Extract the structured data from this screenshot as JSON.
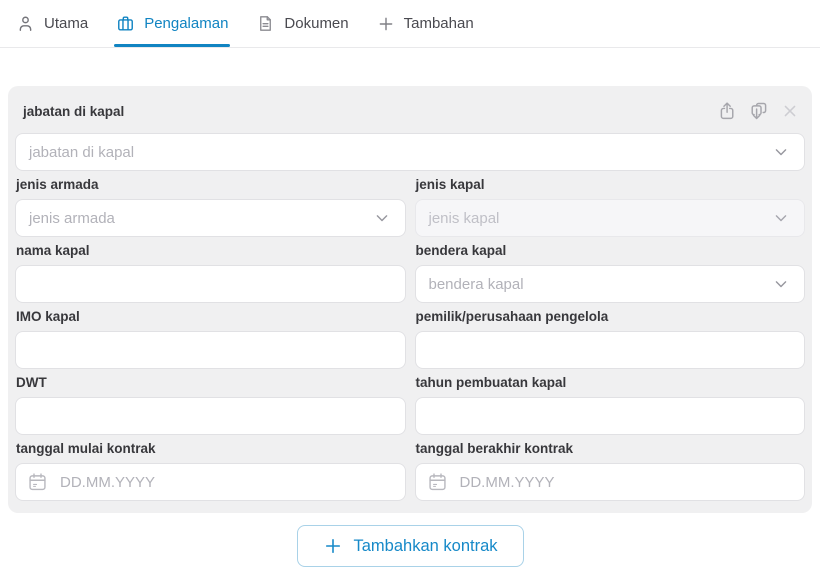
{
  "tabs": {
    "items": [
      {
        "label": "Utama",
        "icon": "user-icon"
      },
      {
        "label": "Pengalaman",
        "icon": "briefcase-icon"
      },
      {
        "label": "Dokumen",
        "icon": "document-icon"
      },
      {
        "label": "Tambahan",
        "icon": "plus-icon"
      }
    ],
    "active": "Pengalaman"
  },
  "card": {
    "title": "jabatan di kapal",
    "header_icons": [
      "share-up-icon",
      "duplicate-icon",
      "close-icon"
    ],
    "position_select": {
      "placeholder": "jabatan di kapal"
    },
    "fields": {
      "jenis_armada": {
        "label": "jenis armada",
        "placeholder": "jenis armada"
      },
      "jenis_kapal": {
        "label": "jenis kapal",
        "placeholder": "jenis kapal",
        "disabled": true
      },
      "nama_kapal": {
        "label": "nama kapal",
        "value": ""
      },
      "bendera_kapal": {
        "label": "bendera kapal",
        "placeholder": "bendera kapal"
      },
      "imo_kapal": {
        "label": "IMO kapal",
        "value": ""
      },
      "pemilik": {
        "label": "pemilik/perusahaan pengelola",
        "value": ""
      },
      "dwt": {
        "label": "DWT",
        "value": ""
      },
      "tahun_pembuatan": {
        "label": "tahun pembuatan kapal",
        "value": ""
      },
      "tanggal_mulai": {
        "label": "tanggal mulai kontrak",
        "placeholder": "DD.MM.YYYY",
        "icon": "calendar-icon"
      },
      "tanggal_berakhir": {
        "label": "tanggal berakhir kontrak",
        "placeholder": "DD.MM.YYYY",
        "icon": "calendar-icon"
      }
    }
  },
  "add_button": {
    "label": "Tambahkan kontrak",
    "icon": "plus-icon"
  },
  "colors": {
    "accent_blue": "#1184c2",
    "button_blue": "#1689c8",
    "button_border": "#a9d2e8",
    "card_bg": "#f0f0f1",
    "input_border": "#e1e1e4",
    "placeholder_gray": "#b2b2b9",
    "label_dark": "#38383c"
  }
}
